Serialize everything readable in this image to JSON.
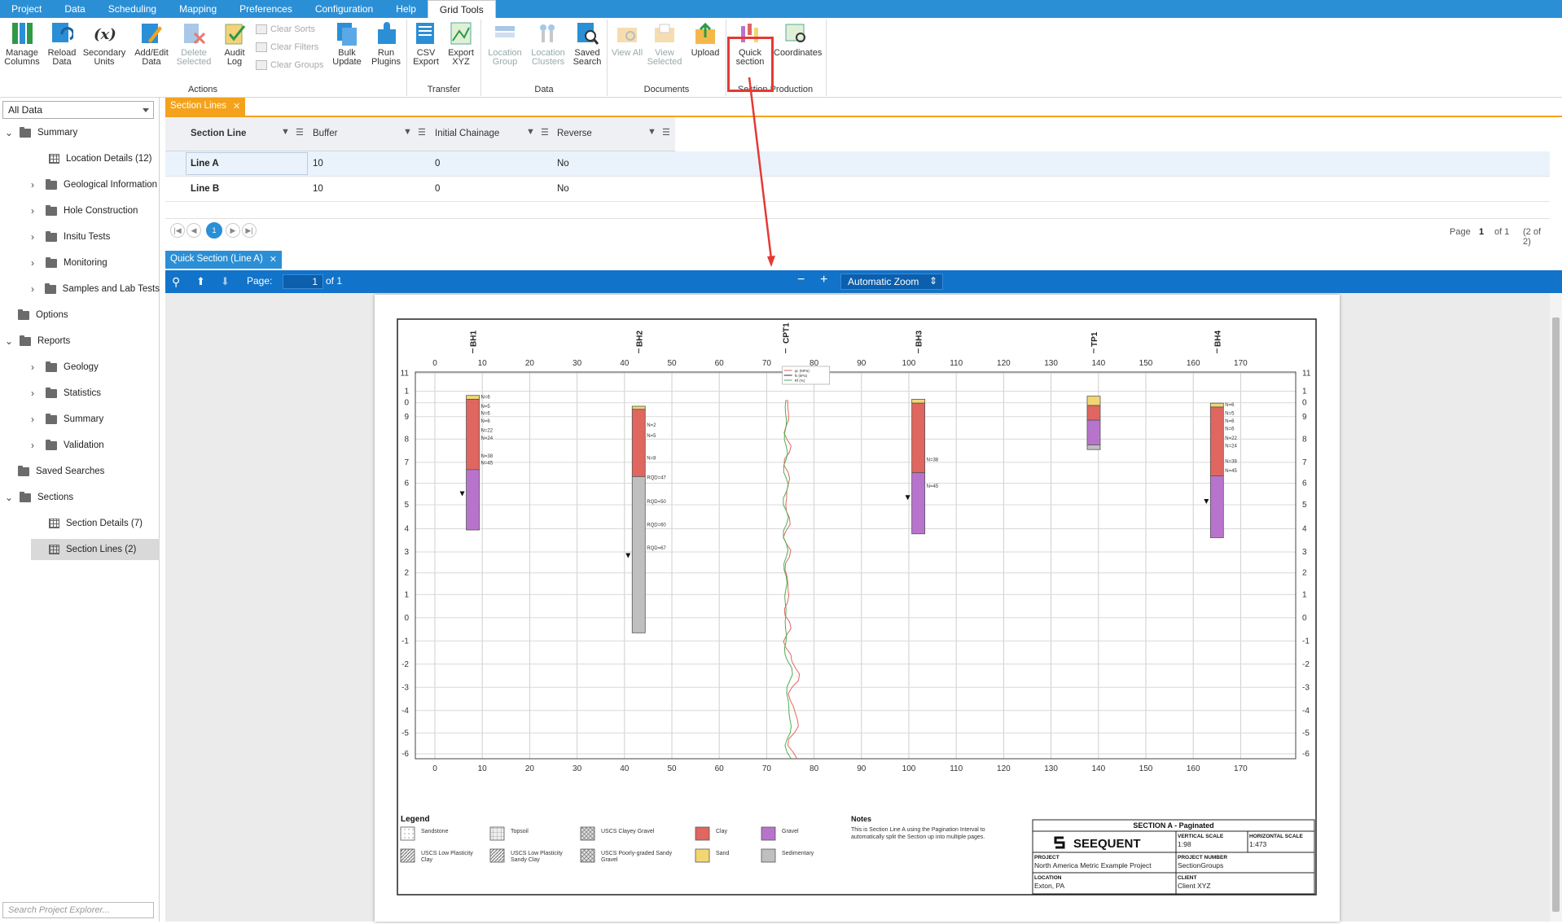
{
  "menu": [
    "Project",
    "Data",
    "Scheduling",
    "Mapping",
    "Preferences",
    "Configuration",
    "Help",
    "Grid Tools"
  ],
  "ribbon": {
    "actions": {
      "manage_columns": "Manage Columns",
      "reload_data": "Reload Data",
      "secondary_units": "Secondary Units",
      "add_edit_data": "Add/Edit Data",
      "delete_selected": "Delete Selected",
      "audit_log": "Audit Log",
      "clear_sorts": "Clear Sorts",
      "clear_filters": "Clear Filters",
      "clear_groups": "Clear Groups",
      "bulk_update": "Bulk Update",
      "run_plugins": "Run Plugins",
      "group_label": "Actions"
    },
    "transfer": {
      "csv_export": "CSV Export",
      "export_xyz": "Export XYZ",
      "group_label": "Transfer"
    },
    "data": {
      "location_group": "Location Group",
      "location_clusters": "Location Clusters",
      "saved_search": "Saved Search",
      "group_label": "Data"
    },
    "documents": {
      "view_all": "View All",
      "view_selected": "View Selected",
      "upload": "Upload",
      "group_label": "Documents"
    },
    "section_production": {
      "quick_section": "Quick section",
      "coordinates": "Coordinates",
      "group_label": "Section Production"
    }
  },
  "explorer": {
    "filter": "All Data",
    "search_placeholder": "Search Project Explorer...",
    "tree": [
      {
        "label": "Summary",
        "kind": "folder",
        "expanded": true
      },
      {
        "label": "Location Details (12)",
        "kind": "grid"
      },
      {
        "label": "Geological Information",
        "kind": "folder"
      },
      {
        "label": "Hole Construction",
        "kind": "folder"
      },
      {
        "label": "Insitu Tests",
        "kind": "folder"
      },
      {
        "label": "Monitoring",
        "kind": "folder"
      },
      {
        "label": "Samples and Lab Tests",
        "kind": "folder"
      },
      {
        "label": "Options",
        "kind": "folder"
      },
      {
        "label": "Reports",
        "kind": "folder",
        "expanded": true
      },
      {
        "label": "Geology",
        "kind": "folder"
      },
      {
        "label": "Statistics",
        "kind": "folder"
      },
      {
        "label": "Summary",
        "kind": "folder"
      },
      {
        "label": "Validation",
        "kind": "folder"
      },
      {
        "label": "Saved Searches",
        "kind": "folder"
      },
      {
        "label": "Sections",
        "kind": "folder",
        "expanded": true
      },
      {
        "label": "Section Details (7)",
        "kind": "grid"
      },
      {
        "label": "Section Lines (2)",
        "kind": "grid",
        "selected": true
      }
    ]
  },
  "grid_tab": "Section Lines",
  "grid": {
    "columns": [
      "Section Line",
      "Buffer",
      "Initial Chainage",
      "Reverse"
    ],
    "rows": [
      [
        "Line A",
        "10",
        "0",
        "No"
      ],
      [
        "Line B",
        "10",
        "0",
        "No"
      ]
    ]
  },
  "pager": {
    "current": "1",
    "page_label": "Page",
    "page_num": "1",
    "of_label": "of 1",
    "count": "(2 of 2)"
  },
  "viewer_tab": "Quick Section (Line A)",
  "viewer": {
    "page_label": "Page:",
    "page": "1",
    "of": "of 1",
    "zoom": "Automatic Zoom"
  },
  "section": {
    "x_ticks": [
      "0",
      "10",
      "20",
      "30",
      "40",
      "50",
      "60",
      "70",
      "80",
      "90",
      "100",
      "110",
      "120",
      "130",
      "140",
      "150",
      "160",
      "170"
    ],
    "y_ticks": [
      "11",
      "1",
      "0",
      "9",
      "8",
      "7",
      "6",
      "5",
      "4",
      "3",
      "2",
      "1",
      "0",
      "-1",
      "-2",
      "-3",
      "-4",
      "-5",
      "-6"
    ],
    "holes": [
      {
        "name": "BH1",
        "x": 8
      },
      {
        "name": "BH2",
        "x": 43
      },
      {
        "name": "CPT1",
        "x": 74
      },
      {
        "name": "BH3",
        "x": 102
      },
      {
        "name": "TP1",
        "x": 139
      },
      {
        "name": "BH4",
        "x": 165
      }
    ],
    "bh1_n": [
      "N=6",
      "N=5",
      "N=6",
      "N=6",
      "N=22",
      "N=24",
      "N=38",
      "N=45"
    ],
    "bh2_n": [
      "N=2",
      "N=5",
      "N=8",
      "RQD=47",
      "RQD=50",
      "RQD=60",
      "RQD=67"
    ],
    "bh3_n": [
      "N=38",
      "N=45"
    ],
    "bh4_n": [
      "N=6",
      "N=5",
      "N=6",
      "N=6",
      "N=22",
      "N=24",
      "N=38",
      "N=45"
    ],
    "cpt_legend": [
      "qc (MPa)",
      "fs (kPa)",
      "Rf (%)"
    ],
    "legend_title": "Legend",
    "legend": [
      {
        "label": "Sandstone",
        "color": "#ffffff",
        "pattern": "dots"
      },
      {
        "label": "Topsoil",
        "color": "#e0e0e0",
        "pattern": "grid"
      },
      {
        "label": "USCS Clayey Gravel",
        "color": "#d8d8d8",
        "pattern": "cross"
      },
      {
        "label": "Clay",
        "color": "#e06660",
        "pattern": "solid"
      },
      {
        "label": "Gravel",
        "color": "#b874cc",
        "pattern": "solid"
      },
      {
        "label": "USCS Low Plasticity Clay",
        "color": "#ffffff",
        "pattern": "hatch"
      },
      {
        "label": "USCS Low Plasticity Sandy Clay",
        "color": "#e0e0e0",
        "pattern": "hatch"
      },
      {
        "label": "USCS Poorly-graded Sandy Gravel",
        "color": "#d8d8d8",
        "pattern": "cross"
      },
      {
        "label": "Sand",
        "color": "#f2d673",
        "pattern": "solid"
      },
      {
        "label": "Sedimentary",
        "color": "#bfbfbf",
        "pattern": "solid"
      }
    ],
    "notes_title": "Notes",
    "notes": "This is Section Line A using the Pagination Interval to automatically split the Section up into multiple pages.",
    "titleblock": {
      "title": "SECTION A - Paginated",
      "brand": "SEEQUENT",
      "vscale_label": "VERTICAL SCALE",
      "vscale": "1:98",
      "hscale_label": "HORIZONTAL SCALE",
      "hscale": "1:473",
      "project_label": "PROJECT",
      "project": "North America Metric Example Project",
      "projnum_label": "PROJECT NUMBER",
      "projnum": "SectionGroups",
      "location_label": "LOCATION",
      "location": "Exton, PA",
      "client_label": "CLIENT",
      "client": "Client XYZ"
    }
  }
}
